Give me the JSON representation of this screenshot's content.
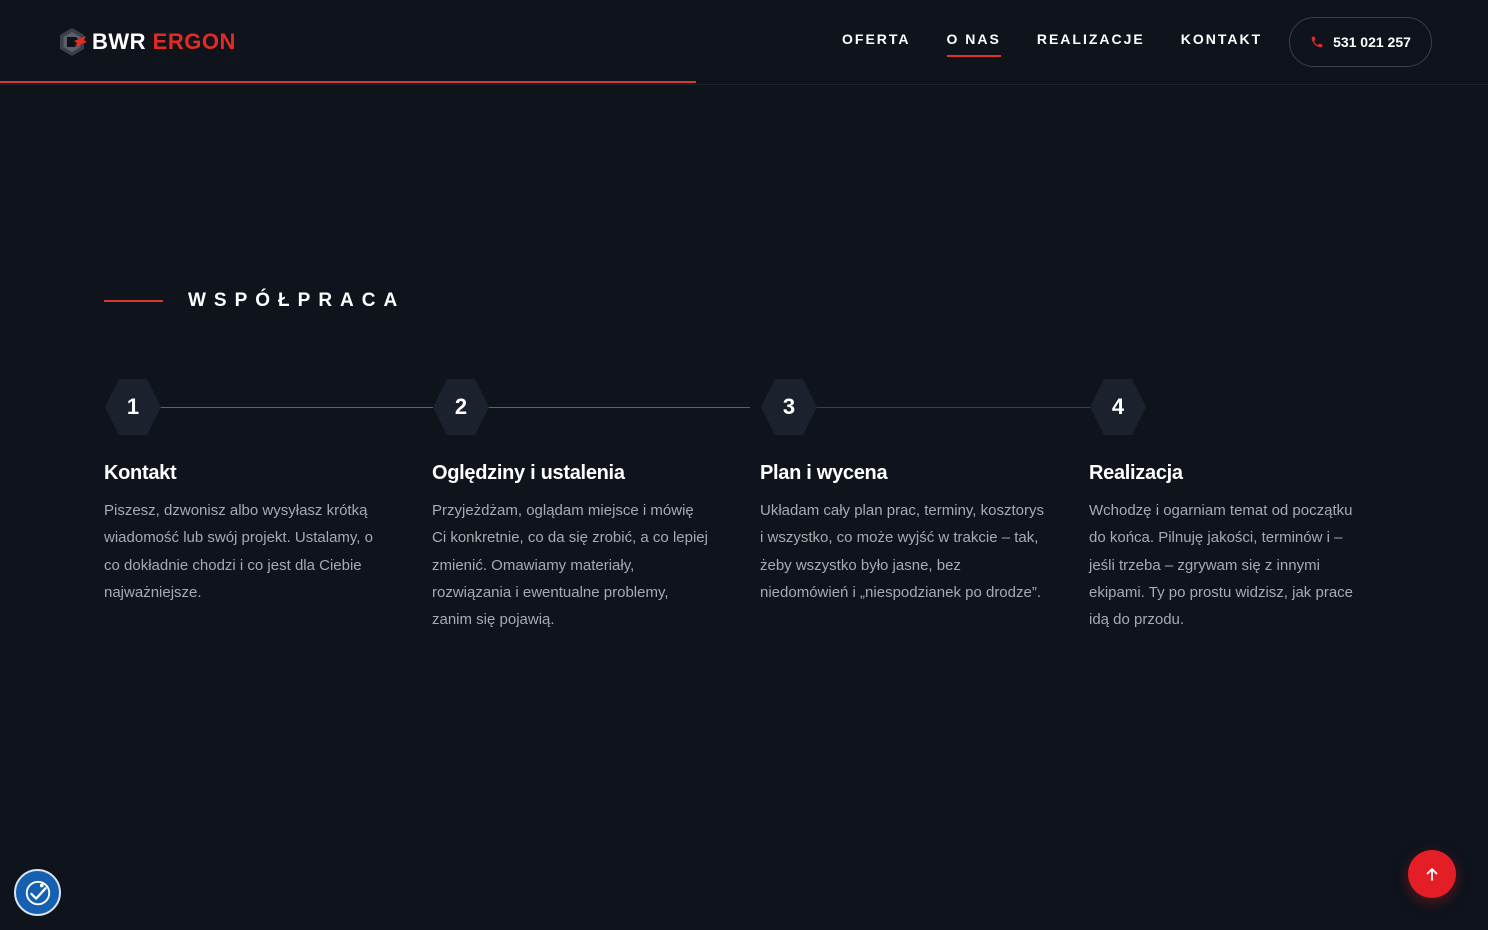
{
  "header": {
    "logo": {
      "word1": "BWR",
      "word2": "ERGON"
    },
    "nav": [
      {
        "label": "OFERTA",
        "active": false
      },
      {
        "label": "O NAS",
        "active": true
      },
      {
        "label": "REALIZACJE",
        "active": false
      },
      {
        "label": "KONTAKT",
        "active": false
      }
    ],
    "phone": {
      "icon": "phone-icon",
      "number": "531 021 257"
    },
    "scroll_progress": 0.468
  },
  "section": {
    "kicker": "WSPÓŁPRACA",
    "steps": [
      {
        "number": "1",
        "title": "Kontakt",
        "text": "Piszesz, dzwonisz albo wysyłasz krótką wiadomość lub swój projekt. Ustalamy, o co dokładnie chodzi i co jest dla Ciebie najważniejsze."
      },
      {
        "number": "2",
        "title": "Oględziny i ustalenia",
        "text": "Przyjeżdżam, oglądam miejsce i mówię Ci konkretnie, co da się zrobić, a co lepiej zmienić. Omawiamy materiały, rozwiązania i ewentualne problemy, zanim się pojawią."
      },
      {
        "number": "3",
        "title": "Plan i wycena",
        "text": "Układam cały plan prac, terminy, kosztorys i wszystko, co może wyjść w trakcie – tak, żeby wszystko było jasne, bez niedomówień i „niespodzianek po drodze”."
      },
      {
        "number": "4",
        "title": "Realizacja",
        "text": "Wchodzę i ogarniam temat od początku do końca. Pilnuję jakości, terminów i – jeśli trzeba – zgrywam się z innymi ekipami. Ty po prostu widzisz, jak prace idą do przodu."
      }
    ]
  },
  "colors": {
    "background": "#0e131c",
    "accent": "#e32b25",
    "text_muted": "#a7aab1",
    "hex_fill": "#1b222d"
  },
  "widgets": {
    "accessibility_icon": "accessibility-icon",
    "scroll_top_icon": "arrow-up-icon"
  }
}
